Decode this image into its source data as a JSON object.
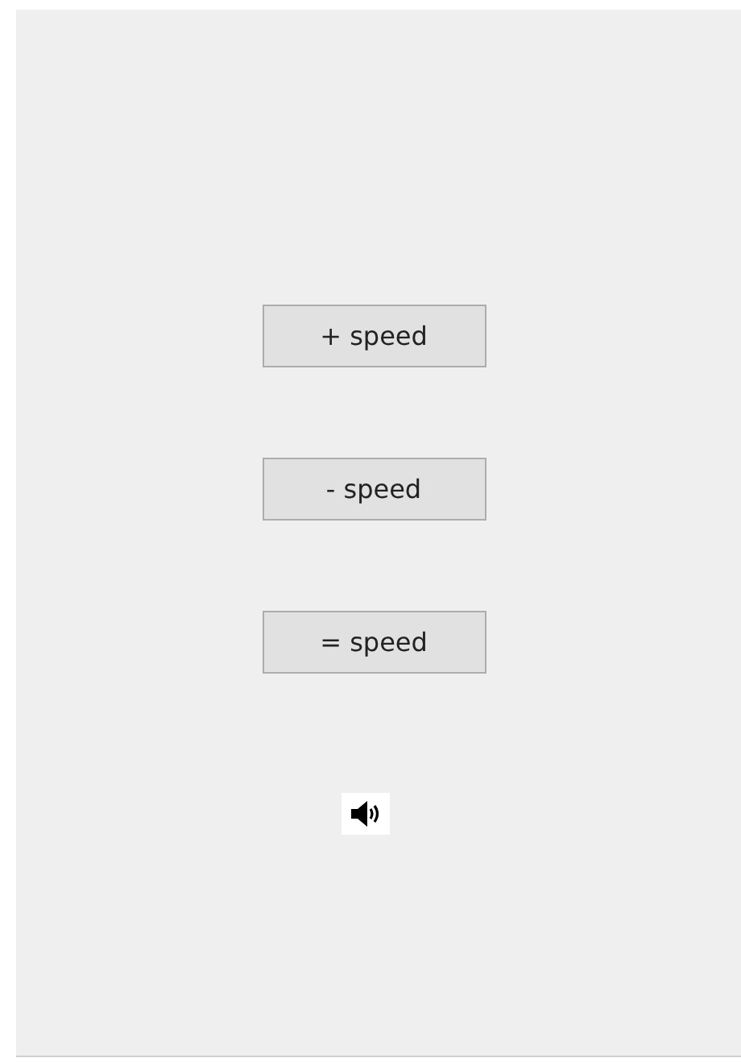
{
  "buttons": [
    {
      "label": "+ speed"
    },
    {
      "label": "- speed"
    },
    {
      "label": "= speed"
    }
  ]
}
